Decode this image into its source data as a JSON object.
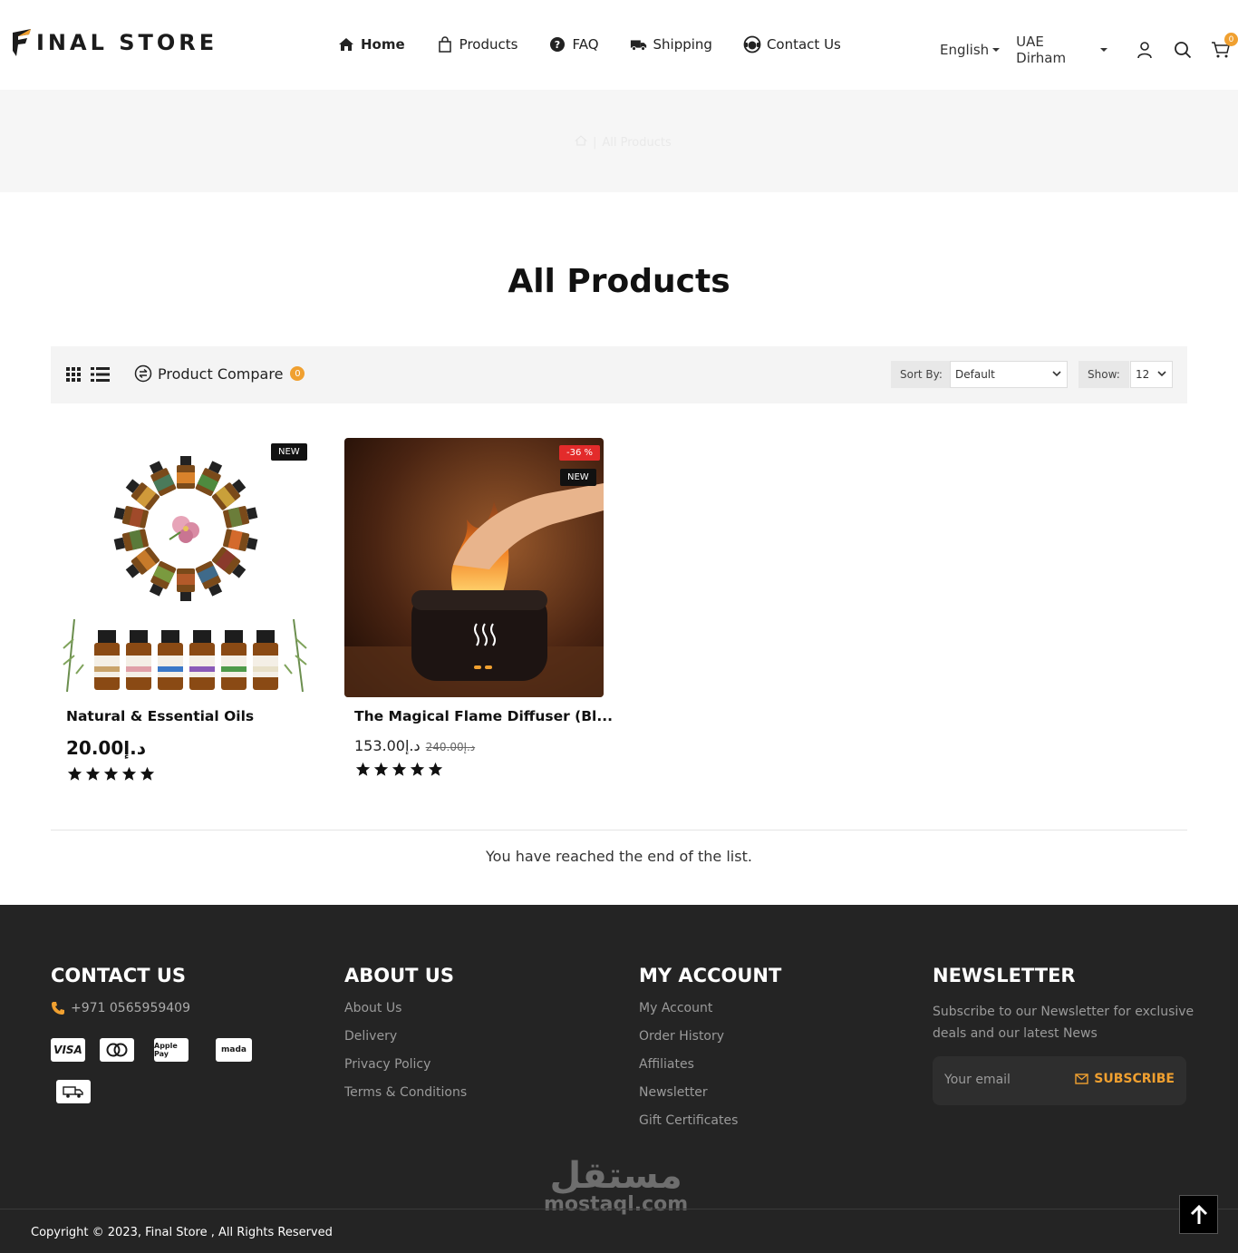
{
  "brand": {
    "name": "INAL STORE",
    "accent": "#f0a030"
  },
  "nav": [
    {
      "label": "Home",
      "icon": "home-icon"
    },
    {
      "label": "Products",
      "icon": "bag-icon"
    },
    {
      "label": "FAQ",
      "icon": "question-icon"
    },
    {
      "label": "Shipping",
      "icon": "truck-icon"
    },
    {
      "label": "Contact Us",
      "icon": "support-icon"
    }
  ],
  "header": {
    "language": "English",
    "currency": "UAE Dirham",
    "cart_count": "0"
  },
  "breadcrumb": {
    "current": "All Products"
  },
  "page": {
    "title": "All Products",
    "end_message": "You have reached the end of the list."
  },
  "toolbar": {
    "compare_label": "Product Compare",
    "compare_count": "0",
    "sort_label": "Sort By:",
    "sort_value": "Default",
    "show_label": "Show:",
    "show_value": "12"
  },
  "products": [
    {
      "name": "Natural & Essential Oils",
      "price": "20.00د.إ",
      "badge_new": "NEW",
      "rating": 5
    },
    {
      "name": "The Magical Flame Diffuser (Bl...",
      "price": "153.00د.إ",
      "old_price": "240.00د.إ",
      "badge_discount": "-36 %",
      "badge_new": "NEW",
      "rating": 5
    }
  ],
  "footer": {
    "contact": {
      "title": "CONTACT US",
      "phone": "+971 0565959409",
      "payments": [
        "VISA",
        "mastercard",
        "Apple Pay",
        "mada",
        "delivery"
      ]
    },
    "about": {
      "title": "ABOUT US",
      "links": [
        "About Us",
        "Delivery",
        "Privacy Policy",
        "Terms & Conditions"
      ]
    },
    "account": {
      "title": "MY ACCOUNT",
      "links": [
        "My Account",
        "Order History",
        "Affiliates",
        "Newsletter",
        "Gift Certificates"
      ]
    },
    "newsletter": {
      "title": "NEWSLETTER",
      "text": "Subscribe to our Newsletter for exclusive deals and our latest News",
      "placeholder": "Your email",
      "button": "SUBSCRIBE"
    },
    "copyright": "Copyright © 2023, Final Store , All Rights Reserved",
    "watermark_ar": "مستقل",
    "watermark_en": "mostaql.com"
  }
}
